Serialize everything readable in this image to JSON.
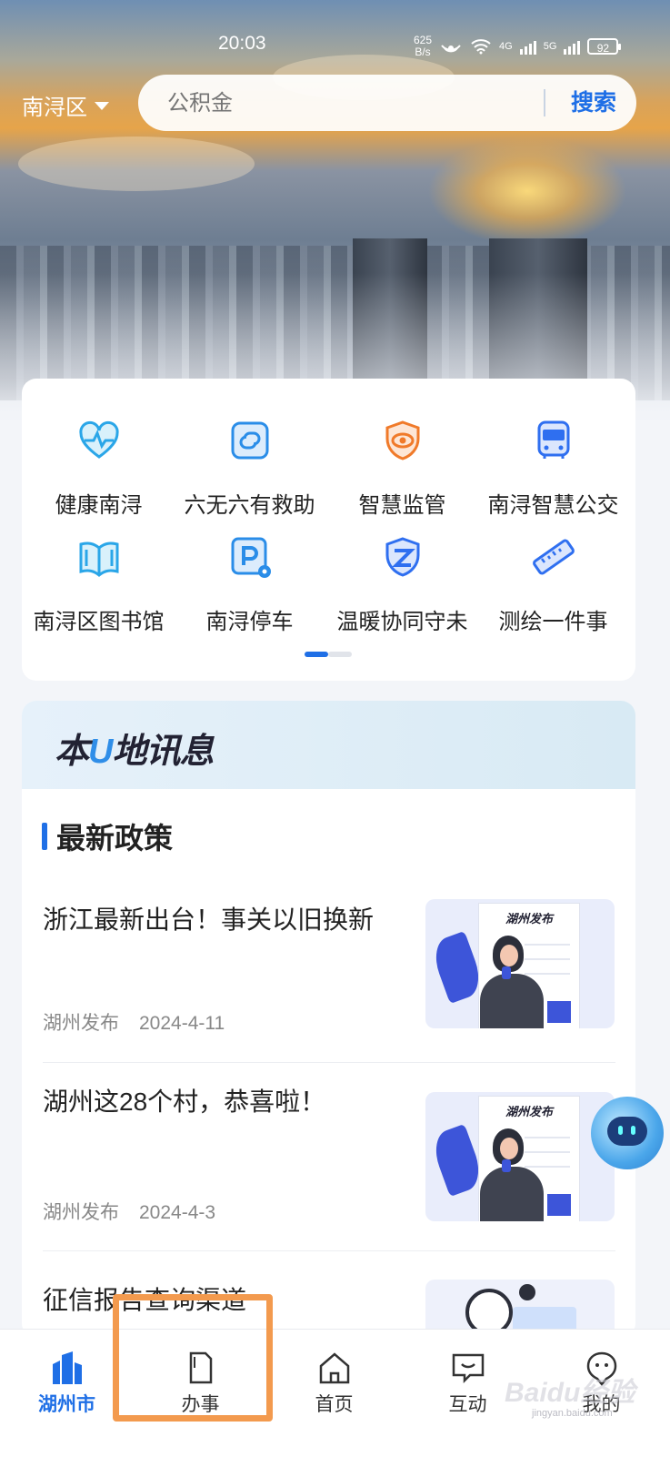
{
  "status_bar": {
    "time": "20:03",
    "net_speed_value": "625",
    "net_speed_unit": "B/s",
    "net_1": "4G",
    "net_2": "5G",
    "battery": "92"
  },
  "header": {
    "region": "南浔区",
    "search_placeholder": "公积金",
    "search_button": "搜索"
  },
  "services": {
    "items": [
      {
        "label": "健康南浔",
        "icon": "heart-pulse-icon",
        "color": "#2aa6e8"
      },
      {
        "label": "六无六有救助",
        "icon": "link-icon",
        "color": "#2a8de8"
      },
      {
        "label": "智慧监管",
        "icon": "eye-shield-icon",
        "color": "#f07a2a"
      },
      {
        "label": "南浔智慧公交",
        "icon": "bus-icon",
        "color": "#2f6ff0"
      },
      {
        "label": "南浔区图书馆",
        "icon": "book-icon",
        "color": "#2aa6e8"
      },
      {
        "label": "南浔停车",
        "icon": "parking-icon",
        "color": "#2a8de8"
      },
      {
        "label": "温暖协同守未",
        "icon": "shield-z-icon",
        "color": "#2f6ff0"
      },
      {
        "label": "测绘一件事",
        "icon": "ruler-icon",
        "color": "#2f6ff0"
      }
    ],
    "page_indicator": {
      "pages": 2,
      "current": 1
    }
  },
  "news": {
    "banner_title_a": "本",
    "banner_title_u": "U",
    "banner_title_b": "地讯息",
    "section_title": "最新政策",
    "items": [
      {
        "headline": "浙江最新出台！事关以旧换新",
        "source": "湖州发布",
        "date": "2024-4-11",
        "thumb_title": "湖州发布"
      },
      {
        "headline": "湖州这28个村，恭喜啦！",
        "source": "湖州发布",
        "date": "2024-4-3",
        "thumb_title": "湖州发布"
      },
      {
        "headline": "征信报告查询渠道",
        "source": "",
        "date": "",
        "thumb_title": ""
      }
    ]
  },
  "tabbar": {
    "tabs": [
      {
        "label": "湖州市",
        "icon": "city-icon",
        "active": true
      },
      {
        "label": "办事",
        "icon": "document-icon",
        "active": false
      },
      {
        "label": "首页",
        "icon": "home-icon",
        "active": false
      },
      {
        "label": "互动",
        "icon": "chat-icon",
        "active": false
      },
      {
        "label": "我的",
        "icon": "user-icon",
        "active": false
      }
    ]
  },
  "watermark": {
    "text": "Baidu经验",
    "sub": "jingyan.baidu.com"
  },
  "colors": {
    "accent": "#1f6fe6",
    "highlight": "#f39a4e"
  }
}
